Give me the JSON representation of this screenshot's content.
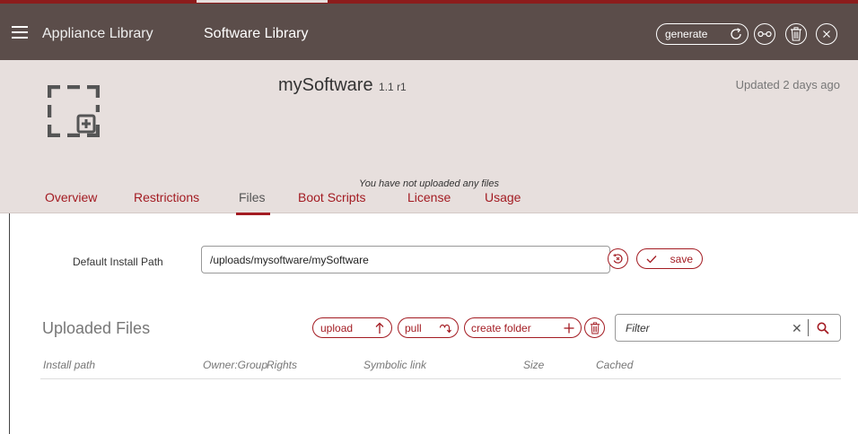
{
  "topbar": {
    "menu_icon": "hamburger-menu-icon",
    "nav": [
      {
        "label": "Appliance Library"
      },
      {
        "label": "Software Library"
      }
    ],
    "generate_label": "generate",
    "colors": {
      "bar": "#5b4d4a",
      "accent": "#8c1c1c"
    }
  },
  "header": {
    "title": "mySoftware",
    "version": "1.1 r1",
    "updated": "Updated 2 days ago",
    "tabs": [
      {
        "label": "Overview"
      },
      {
        "label": "Restrictions"
      },
      {
        "label": "Files"
      },
      {
        "label": "Boot Scripts"
      },
      {
        "label": "License"
      },
      {
        "label": "Usage"
      }
    ],
    "active_tab": "Files"
  },
  "install_path": {
    "label": "Default Install Path",
    "value": "/uploads/mysoftware/mySoftware",
    "save_label": "save"
  },
  "uploaded_files": {
    "title": "Uploaded Files",
    "upload_label": "upload",
    "pull_label": "pull",
    "create_folder_label": "create folder",
    "filter_placeholder": "Filter",
    "columns": [
      "Install path",
      "Owner:Group",
      "Rights",
      "Symbolic link",
      "Size",
      "Cached"
    ],
    "empty_message": "You have not uploaded any files"
  },
  "colors": {
    "accent_red": "#a31b22",
    "header_bg": "#e7dfdd"
  }
}
